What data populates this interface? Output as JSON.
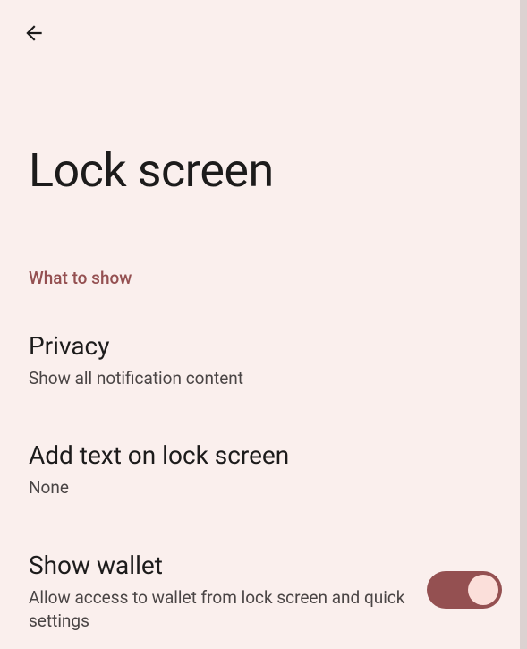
{
  "header": {
    "title": "Lock screen"
  },
  "section": {
    "header": "What to show"
  },
  "settings": {
    "privacy": {
      "title": "Privacy",
      "summary": "Show all notification content"
    },
    "addText": {
      "title": "Add text on lock screen",
      "summary": "None"
    },
    "showWallet": {
      "title": "Show wallet",
      "summary": "Allow access to wallet from lock screen and quick settings",
      "enabled": true
    }
  }
}
